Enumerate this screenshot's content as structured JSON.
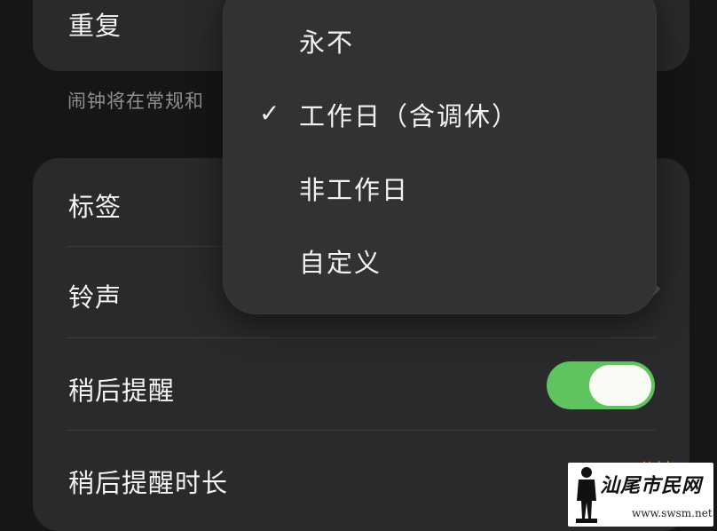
{
  "repeat": {
    "label": "重复",
    "footnote": "闹钟将在常规和"
  },
  "options": {
    "tag_label": "标签",
    "ringtone_label": "铃声",
    "snooze_label": "稍后提醒",
    "snooze_enabled": true,
    "snooze_duration_label": "稍后提醒时长",
    "snooze_duration_value": "分钟"
  },
  "repeat_menu": {
    "items": [
      "永不",
      "工作日（含调休）",
      "非工作日",
      "自定义"
    ],
    "selected_index": 1,
    "check_glyph": "✓"
  },
  "watermark": {
    "title": "汕尾市民网",
    "url": "www.swsm.net"
  },
  "colors": {
    "background": "#161616",
    "card": "#2a2a2c",
    "menu": "#323234",
    "toggle_on": "#5fc45f",
    "accent_orange": "#d97a2e"
  }
}
